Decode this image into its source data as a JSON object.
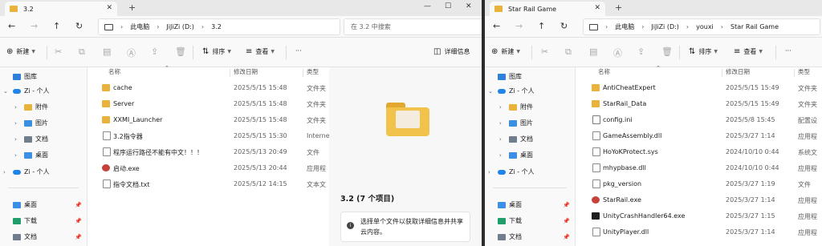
{
  "colors": {
    "accent": "#0067c0",
    "folder": "#e9b23b",
    "onedrive": "#1f84e6"
  },
  "left": {
    "tab_title": "3.2",
    "address": [
      "此电脑",
      "JiJiZi (D:)",
      "3.2"
    ],
    "search_placeholder": "在 3.2 中搜索",
    "cmd": {
      "new": "新建",
      "sort": "排序",
      "view": "查看",
      "more": "···",
      "details": "详细信息"
    },
    "headers": {
      "name": "名称",
      "date": "修改日期",
      "type": "类型"
    },
    "sidebar": [
      {
        "label": "图库",
        "icon": "gallery-icon",
        "chevron": ""
      },
      {
        "label": "Zi - 个人",
        "icon": "onedrive-icon",
        "chevron": "⌄"
      },
      {
        "label": "附件",
        "icon": "folder-icon",
        "chevron": "›"
      },
      {
        "label": "图片",
        "icon": "pictures-icon",
        "chevron": "›"
      },
      {
        "label": "文档",
        "icon": "documents-icon",
        "chevron": "›"
      },
      {
        "label": "桌面",
        "icon": "desktop-icon",
        "chevron": "›"
      },
      {
        "label": "Zi - 个人",
        "icon": "onedrive-icon",
        "chevron": "›"
      },
      {
        "label": "桌面",
        "icon": "desktop-icon",
        "chevron": "",
        "pinned": true
      },
      {
        "label": "下载",
        "icon": "download-icon",
        "chevron": "",
        "pinned": true
      },
      {
        "label": "文档",
        "icon": "documents-icon",
        "chevron": "",
        "pinned": true
      }
    ],
    "files": [
      {
        "name": "cache",
        "date": "2025/5/15 15:48",
        "type": "文件夹",
        "icon": "folder"
      },
      {
        "name": "Server",
        "date": "2025/5/15 15:48",
        "type": "文件夹",
        "icon": "folder"
      },
      {
        "name": "XXMI_Launcher",
        "date": "2025/5/15 15:48",
        "type": "文件夹",
        "icon": "folder"
      },
      {
        "name": "3.2指令器",
        "date": "2025/5/15 15:30",
        "type": "Interne",
        "icon": "doc"
      },
      {
        "name": "程序运行路径不能有中文！！！",
        "date": "2025/5/13 20:49",
        "type": "文件",
        "icon": "doc"
      },
      {
        "name": "启动.exe",
        "date": "2025/5/13 20:44",
        "type": "应用程",
        "icon": "exe"
      },
      {
        "name": "指令文档.txt",
        "date": "2025/5/12 14:15",
        "type": "文本文",
        "icon": "doc"
      }
    ],
    "details_title": "3.2 (7 个项目)",
    "details_info": "选择单个文件以获取详细信息并共享云内容。"
  },
  "right": {
    "tab_title": "Star Rail Game",
    "address": [
      "此电脑",
      "JiJiZi (D:)",
      "youxi",
      "Star Rail Game"
    ],
    "cmd": {
      "new": "新建",
      "sort": "排序",
      "view": "查看",
      "more": "···"
    },
    "headers": {
      "name": "名称",
      "date": "修改日期",
      "type": "类型"
    },
    "sidebar": [
      {
        "label": "图库",
        "icon": "gallery-icon",
        "chevron": ""
      },
      {
        "label": "Zi - 个人",
        "icon": "onedrive-icon",
        "chevron": "⌄"
      },
      {
        "label": "附件",
        "icon": "folder-icon",
        "chevron": "›"
      },
      {
        "label": "图片",
        "icon": "pictures-icon",
        "chevron": "›"
      },
      {
        "label": "文档",
        "icon": "documents-icon",
        "chevron": "›"
      },
      {
        "label": "桌面",
        "icon": "desktop-icon",
        "chevron": "›"
      },
      {
        "label": "Zi - 个人",
        "icon": "onedrive-icon",
        "chevron": "›"
      },
      {
        "label": "桌面",
        "icon": "desktop-icon",
        "chevron": "",
        "pinned": true
      },
      {
        "label": "下载",
        "icon": "download-icon",
        "chevron": "",
        "pinned": true
      },
      {
        "label": "文档",
        "icon": "documents-icon",
        "chevron": "",
        "pinned": true
      }
    ],
    "files": [
      {
        "name": "AntiCheatExpert",
        "date": "2025/5/15 15:49",
        "type": "文件夹",
        "icon": "folder"
      },
      {
        "name": "StarRail_Data",
        "date": "2025/5/15 15:49",
        "type": "文件夹",
        "icon": "folder"
      },
      {
        "name": "config.ini",
        "date": "2025/5/8 15:45",
        "type": "配置设",
        "icon": "cfg"
      },
      {
        "name": "GameAssembly.dll",
        "date": "2025/3/27 1:14",
        "type": "应用程",
        "icon": "dll"
      },
      {
        "name": "HoYoKProtect.sys",
        "date": "2024/10/10 0:44",
        "type": "系统文",
        "icon": "dll"
      },
      {
        "name": "mhypbase.dll",
        "date": "2024/10/10 0:44",
        "type": "应用程",
        "icon": "dll"
      },
      {
        "name": "pkg_version",
        "date": "2025/3/27 1:19",
        "type": "文件",
        "icon": "doc"
      },
      {
        "name": "StarRail.exe",
        "date": "2025/3/27 1:14",
        "type": "应用程",
        "icon": "exe"
      },
      {
        "name": "UnityCrashHandler64.exe",
        "date": "2025/3/27 1:15",
        "type": "应用程",
        "icon": "app"
      },
      {
        "name": "UnityPlayer.dll",
        "date": "2025/3/27 1:14",
        "type": "应用程",
        "icon": "dll"
      }
    ]
  }
}
